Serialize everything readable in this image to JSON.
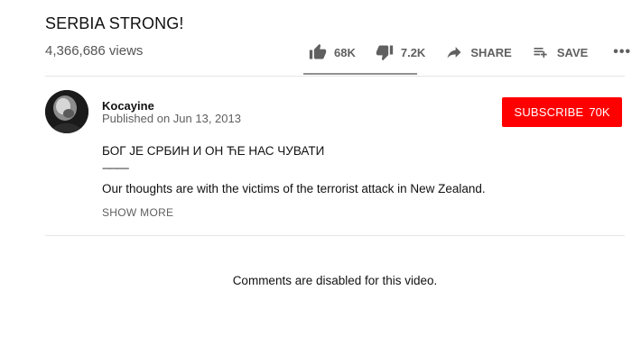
{
  "video": {
    "title": "SERBIA STRONG!",
    "views": "4,366,686 views"
  },
  "actions": {
    "like_count": "68K",
    "dislike_count": "7.2K",
    "share_label": "SHARE",
    "save_label": "SAVE",
    "more_label": "•••",
    "like_ratio": 0.9
  },
  "channel": {
    "name": "Kocayine",
    "published": "Published on Jun 13, 2013",
    "subscribe_label": "SUBSCRIBE",
    "subscriber_count": "70K"
  },
  "description": {
    "line1": "БОГ ЈЕ СРБИН И ОН ЋЕ НАС ЧУВАТИ",
    "line2": "-----------",
    "line3": "Our thoughts are with the victims of the terrorist attack in New Zealand.",
    "show_more": "SHOW MORE"
  },
  "comments": {
    "status": "Comments are disabled for this video."
  },
  "colors": {
    "subscribe_bg": "#ff0000",
    "secondary_text": "#606060"
  },
  "icons": {
    "like": "thumb-up-icon",
    "dislike": "thumb-down-icon",
    "share": "share-arrow-icon",
    "save": "playlist-add-icon",
    "more": "more-horizontal-icon"
  }
}
